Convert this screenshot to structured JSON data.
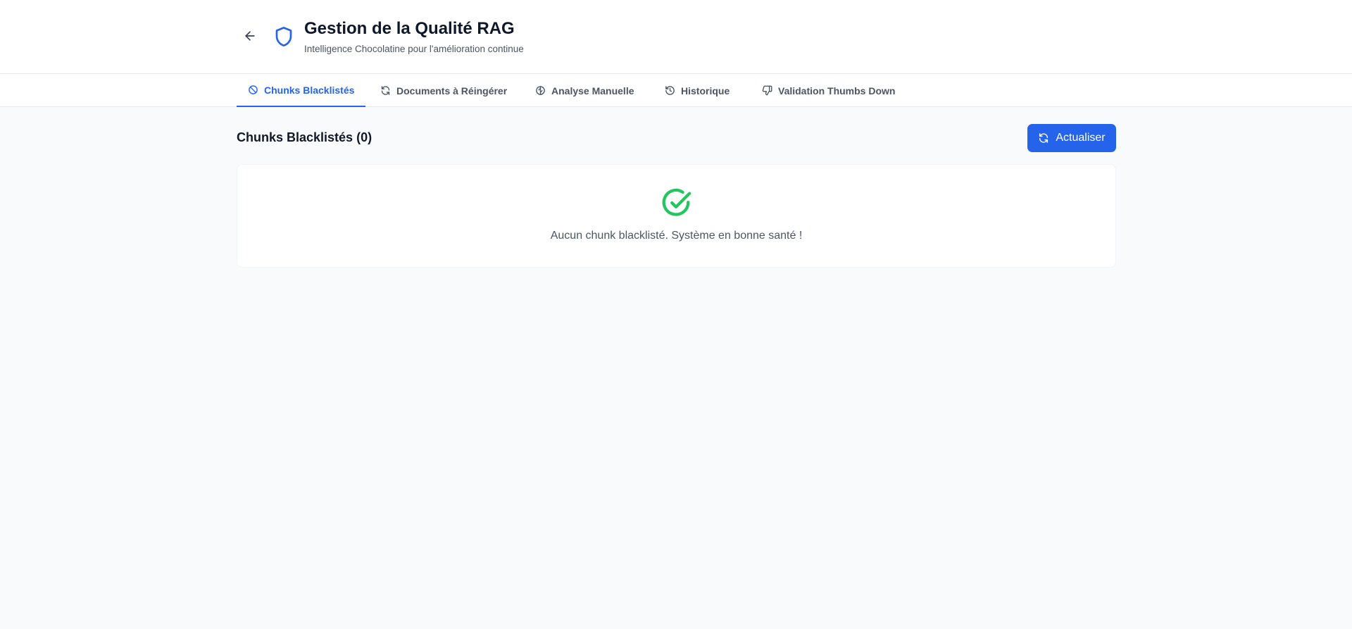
{
  "header": {
    "title": "Gestion de la Qualité RAG",
    "subtitle": "Intelligence Chocolatine pour l'amélioration continue",
    "back_icon": "arrow-left-icon",
    "logo_icon": "shield-icon"
  },
  "tabs": [
    {
      "label": "Chunks Blacklistés",
      "icon": "ban-icon",
      "active": true
    },
    {
      "label": "Documents à Réingérer",
      "icon": "refresh-icon",
      "active": false
    },
    {
      "label": "Analyse Manuelle",
      "icon": "brain-icon",
      "active": false
    },
    {
      "label": "Historique",
      "icon": "history-icon",
      "active": false
    },
    {
      "label": "Validation Thumbs Down",
      "icon": "thumbs-down-icon",
      "active": false
    }
  ],
  "main": {
    "section_title": "Chunks Blacklistés (0)",
    "refresh_label": "Actualiser",
    "empty_message": "Aucun chunk blacklisté. Système en bonne santé !",
    "empty_icon": "check-circle-icon"
  },
  "colors": {
    "accent": "#2563eb",
    "success": "#22c55e",
    "background": "#f8fafc"
  }
}
